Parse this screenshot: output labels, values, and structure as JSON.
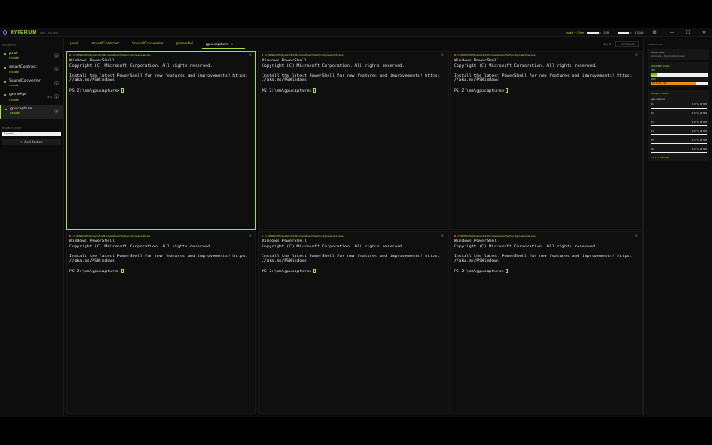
{
  "app": {
    "brand": "HYPERIUM",
    "subbrand": "DEV - MAXED",
    "meter1_label": "next ~29m",
    "meter1_fill": 0.85,
    "meter1_count": "5/8",
    "meter2_fill": 0.8,
    "meter2_count": "23/40",
    "colors": {
      "accent": "#a6e22e",
      "focus": "#a6e22e",
      "close_dot": "#e24a3a",
      "ram": "#f08a24"
    }
  },
  "sidebar": {
    "heading": "PROJECTS",
    "projects": [
      {
        "name": "pool",
        "sub": "claude",
        "count": "0",
        "extra": ""
      },
      {
        "name": "smartContract",
        "sub": "claude",
        "count": "1",
        "extra": ""
      },
      {
        "name": "SoundConverter",
        "sub": "claude",
        "count": "1",
        "extra": ""
      },
      {
        "name": "gameApi",
        "sub": "claude",
        "count": "1",
        "extra": "4 h"
      },
      {
        "name": "gpucapture",
        "sub": "claude",
        "count": "6",
        "extra": ""
      }
    ],
    "active_index": 4,
    "root_label": "PROJECTS ROOT",
    "root_value": "Z:\\mm\\",
    "add_folder_label": "+ Add folder"
  },
  "tabs": {
    "items": [
      "pool",
      "smartContract",
      "SoundConverter",
      "gameApi",
      "gpucapture"
    ],
    "active_index": 4,
    "close_glyph": "×",
    "pane_count": "6 / 6",
    "settings_label": "+ SETTINGS"
  },
  "terminals": [
    {
      "path": "C:\\WINDOWS\\System32\\WindowsPowerShell\\v1.0\\powershell.exe",
      "focused": true
    },
    {
      "path": "C:\\WINDOWS\\System32\\WindowsPowerShell\\v1.0\\powershell.exe",
      "focused": false
    },
    {
      "path": "C:\\WINDOWS\\System32\\WindowsPowerShell\\v1.0\\powershell.exe",
      "focused": false
    },
    {
      "path": "C:\\WINDOWS\\System32\\WindowsPowerShell\\v1.0\\powershell.exe",
      "focused": false
    },
    {
      "path": "C:\\WINDOWS\\System32\\WindowsPowerShell\\v1.0\\powershell.exe",
      "focused": false
    },
    {
      "path": "C:\\WINDOWS\\System32\\WindowsPowerShell\\v1.0\\powershell.exe",
      "focused": false
    }
  ],
  "terminal_text": {
    "line1": "Windows PowerShell",
    "line2": "Copyright (C) Microsoft Corporation. All rights reserved.",
    "line3": "Install the latest PowerShell for new features and improvements! https:",
    "line4": "//aka.ms/PSWindows",
    "prompt": "PS Z:\\mm\\gpucapture>",
    "close_glyph": "×"
  },
  "inspector": {
    "title": "INSPECTOR",
    "drop_title": "DROP JOBS",
    "drop_sub": "terminals - drop badle drused",
    "machine_title": "MACHINE LOAD",
    "cpu_label": "CPU",
    "cpu_value": "11%",
    "cpu_fill": 0.11,
    "ram_label": "RAM",
    "ram_value": "78.9 GB / 95",
    "ram_fill": 0.78,
    "project_title": "PROJECT LOAD",
    "project_root": "gpucapture",
    "rows": [
      {
        "name": "#1",
        "stats": "0.0 %   38 MB"
      },
      {
        "name": "#2",
        "stats": "0.0 %   38 MB"
      },
      {
        "name": "#3",
        "stats": "0.0 %   38 MB"
      },
      {
        "name": "#4",
        "stats": "0.0 %   38 MB"
      },
      {
        "name": "#5",
        "stats": "0.1 %   38 MB"
      },
      {
        "name": "#6",
        "stats": "0.0 %   38 MB"
      }
    ],
    "total": "Σ 0.1 %   230 MB"
  }
}
